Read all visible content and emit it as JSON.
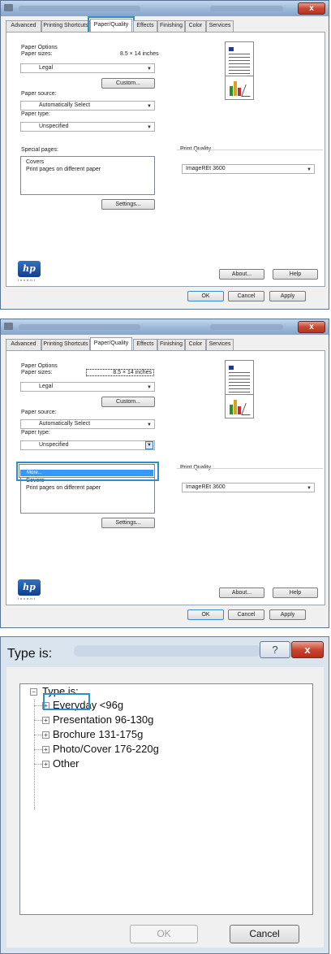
{
  "props": {
    "tabs": [
      "Advanced",
      "Printing Shortcuts",
      "Paper/Quality",
      "Effects",
      "Finishing",
      "Color",
      "Services"
    ],
    "paper_options_label": "Paper Options",
    "paper_sizes_label": "Paper sizes:",
    "paper_size_dims": "8.5 × 14 inches",
    "paper_size_value": "Legal",
    "custom_button": "Custom...",
    "paper_source_label": "Paper source:",
    "paper_source_value": "Automatically Select",
    "paper_type_label": "Paper type:",
    "paper_type_value": "Unspecified",
    "special_pages_label": "Special pages:",
    "special_pages_items": [
      "Covers",
      "Print pages on different paper"
    ],
    "settings_button": "Settings...",
    "print_quality_label": "Print Quality",
    "print_quality_value": "ImageREt 3600",
    "about_button": "About...",
    "help_button": "Help",
    "ok_button": "OK",
    "cancel_button": "Cancel",
    "apply_button": "Apply",
    "hp_logo": "hp",
    "hp_tagline": "invent",
    "dropdown_option_more": "More..."
  },
  "typeis": {
    "title": "Type is:",
    "help_icon_glyph": "?",
    "close_icon_glyph": "x",
    "root_label": "Type is:",
    "items": [
      "Everyday <96g",
      "Presentation 96-130g",
      "Brochure 131-175g",
      "Photo/Cover 176-220g",
      "Other"
    ],
    "ok_button": "OK",
    "cancel_button": "Cancel"
  }
}
